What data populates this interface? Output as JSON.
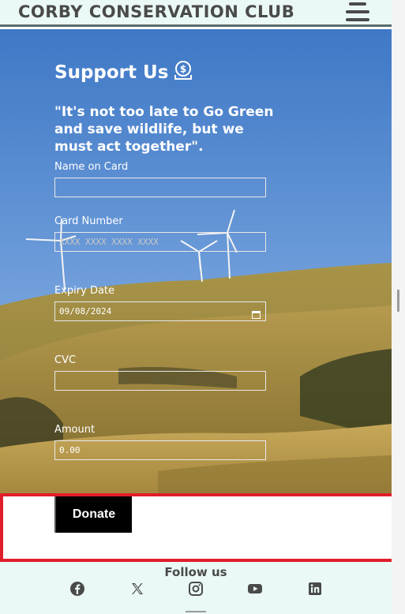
{
  "header": {
    "site_title": "CORBY CONSERVATION CLUB",
    "menu_icon": "hamburger-menu-icon"
  },
  "support": {
    "title": "Support Us",
    "title_icon": "money-bag-dollar-icon",
    "quote": "\"It's not too late to Go Green and save wildlife, but we must act together\"."
  },
  "form": {
    "name_label": "Name on Card",
    "name_value": "",
    "card_label": "Card Number",
    "card_placeholder": "XXXX XXXX XXXX XXXX",
    "expiry_label": "Expiry Date",
    "expiry_value": "09/08/2024",
    "cvc_label": "CVC",
    "cvc_value": "",
    "amount_label": "Amount",
    "amount_value": "0.00"
  },
  "donate": {
    "button_label": "Donate"
  },
  "footer": {
    "follow_label": "Follow us",
    "social": [
      "facebook",
      "x-twitter",
      "instagram",
      "youtube",
      "linkedin"
    ]
  },
  "colors": {
    "header_bg": "#eaf9f6",
    "header_text": "#4a4a4a",
    "highlight_border": "#e01d2a",
    "donate_bg": "#000000"
  }
}
